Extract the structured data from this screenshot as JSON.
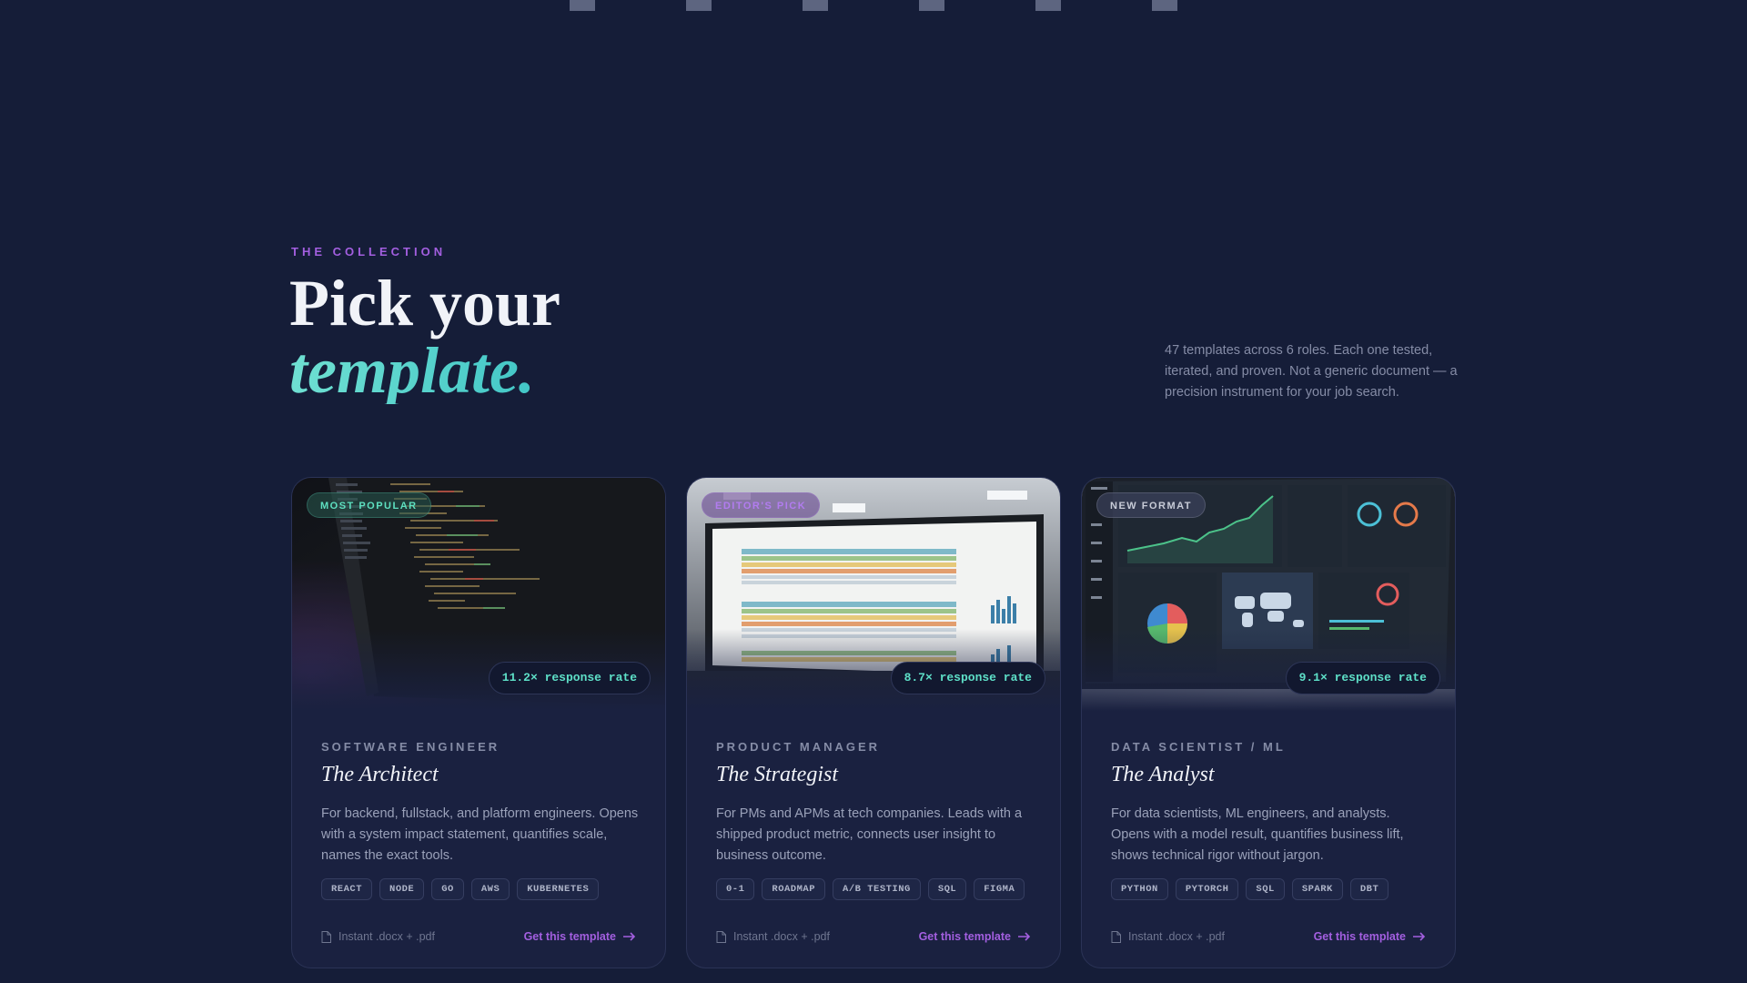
{
  "section": {
    "eyebrow": "THE COLLECTION",
    "title_line1": "Pick your",
    "title_line2": "template.",
    "intro": "47 templates across 6 roles. Each one tested, iterated, and proven. Not a generic document — a precision instrument for your job search."
  },
  "colors": {
    "background": "#151d38",
    "accent_purple": "#a35fe0",
    "accent_teal": "#4fd1c5",
    "card": "#1a2140"
  },
  "cards": [
    {
      "badge": "MOST POPULAR",
      "rate": "11.2× response rate",
      "role": "SOFTWARE ENGINEER",
      "name": "The Architect",
      "description": "For backend, fullstack, and platform engineers. Opens with a system impact statement, quantifies scale, names the exact tools.",
      "tags": [
        "REACT",
        "NODE",
        "GO",
        "AWS",
        "KUBERNETES"
      ],
      "format": "Instant .docx + .pdf",
      "cta": "Get this template",
      "image": "code-editor-screen"
    },
    {
      "badge": "EDITOR'S PICK",
      "rate": "8.7× response rate",
      "role": "PRODUCT MANAGER",
      "name": "The Strategist",
      "description": "For PMs and APMs at tech companies. Leads with a shipped product metric, connects user insight to business outcome.",
      "tags": [
        "0-1",
        "ROADMAP",
        "A/B TESTING",
        "SQL",
        "FIGMA"
      ],
      "format": "Instant .docx + .pdf",
      "cta": "Get this template",
      "image": "product-roadmap-screen"
    },
    {
      "badge": "NEW FORMAT",
      "rate": "9.1× response rate",
      "role": "DATA SCIENTIST / ML",
      "name": "The Analyst",
      "description": "For data scientists, ML engineers, and analysts. Opens with a model result, quantifies business lift, shows technical rigor without jargon.",
      "tags": [
        "PYTHON",
        "PYTORCH",
        "SQL",
        "SPARK",
        "DBT"
      ],
      "format": "Instant .docx + .pdf",
      "cta": "Get this template",
      "image": "analytics-dashboard-screen"
    }
  ]
}
